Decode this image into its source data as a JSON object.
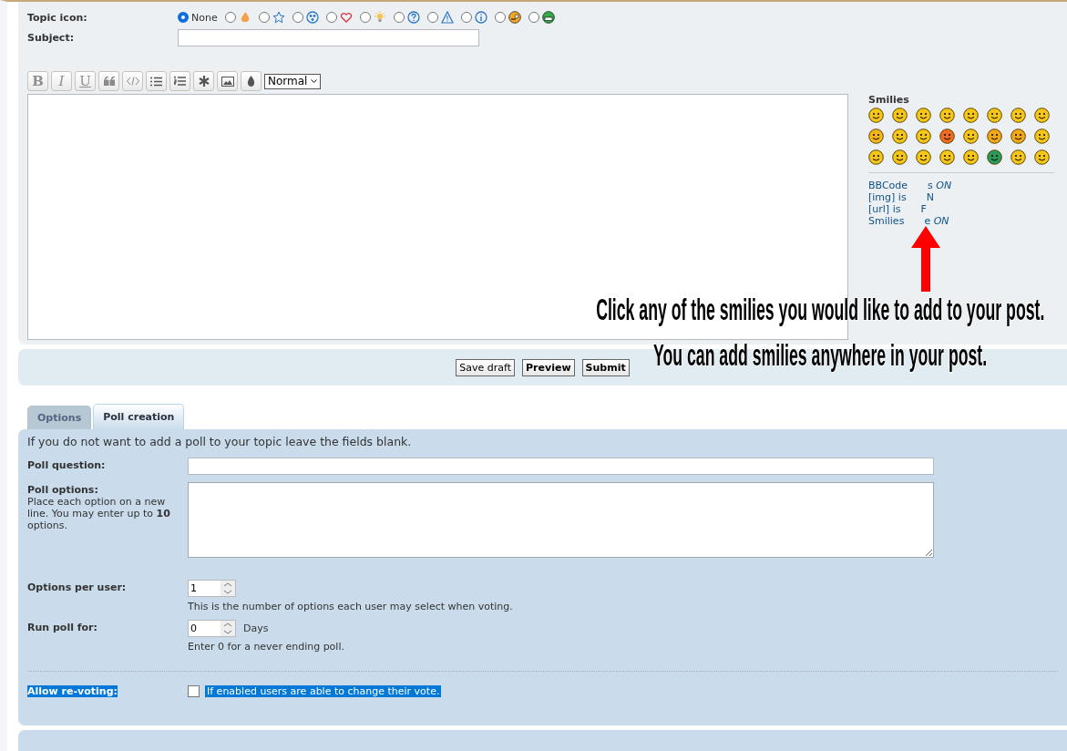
{
  "post_form": {
    "topic_icon_label": "Topic icon:",
    "topic_icons": [
      {
        "kind": "none",
        "label": "None",
        "selected": true
      },
      {
        "kind": "fire",
        "selected": false
      },
      {
        "kind": "star",
        "selected": false
      },
      {
        "kind": "radioactive",
        "selected": false
      },
      {
        "kind": "heart",
        "selected": false
      },
      {
        "kind": "lightbulb",
        "selected": false
      },
      {
        "kind": "question",
        "selected": false
      },
      {
        "kind": "warning",
        "selected": false
      },
      {
        "kind": "info",
        "selected": false
      },
      {
        "kind": "wink",
        "selected": false
      },
      {
        "kind": "grin",
        "selected": false
      }
    ],
    "subject_label": "Subject:",
    "toolbar": [
      {
        "kind": "text",
        "label": "B"
      },
      {
        "kind": "text",
        "label": "I"
      },
      {
        "kind": "text",
        "label": "U"
      },
      {
        "kind": "quote"
      },
      {
        "kind": "code"
      },
      {
        "kind": "list"
      },
      {
        "kind": "numbered-list"
      },
      {
        "kind": "asterisk"
      },
      {
        "kind": "image"
      },
      {
        "kind": "drop"
      }
    ],
    "font_size": "Normal",
    "smilies_title": "Smilies",
    "status_lines": [
      {
        "left": "BBCode",
        "right": "s *ON*"
      },
      {
        "left": "[img] is",
        "right": "N"
      },
      {
        "left": "[url] is",
        "right": "F"
      },
      {
        "left": "Smilies",
        "right": "e *ON*"
      }
    ],
    "buttons": [
      {
        "label": "Save draft",
        "primary": false
      },
      {
        "label": "Preview",
        "primary": true
      },
      {
        "label": "Submit",
        "primary": true
      }
    ]
  },
  "annotation": [
    "Click any of the smilies you would like to add to your post.",
    "You can add smilies anywhere in your post."
  ],
  "tabs": [
    {
      "label": "Options",
      "selected": false
    },
    {
      "label": "Poll creation",
      "selected": true
    }
  ],
  "poll": {
    "intro": "If you do not want to add a poll to your topic leave the fields blank.",
    "question_label": "Poll question:",
    "options_label": "Poll options:",
    "options_hint": "Place each option on a new line. You may enter up to **10** options.",
    "per_user_label": "Options per user:",
    "per_user_value": "1",
    "per_user_hint": "This is the number of options each user may select when voting.",
    "run_label": "Run poll for:",
    "run_value": "0",
    "run_unit": "Days",
    "run_hint": "Enter 0 for a never ending poll.",
    "revote_label": "Allow re-voting:",
    "revote_checked": false,
    "revote_hint": "If enabled users are able to change their vote."
  }
}
